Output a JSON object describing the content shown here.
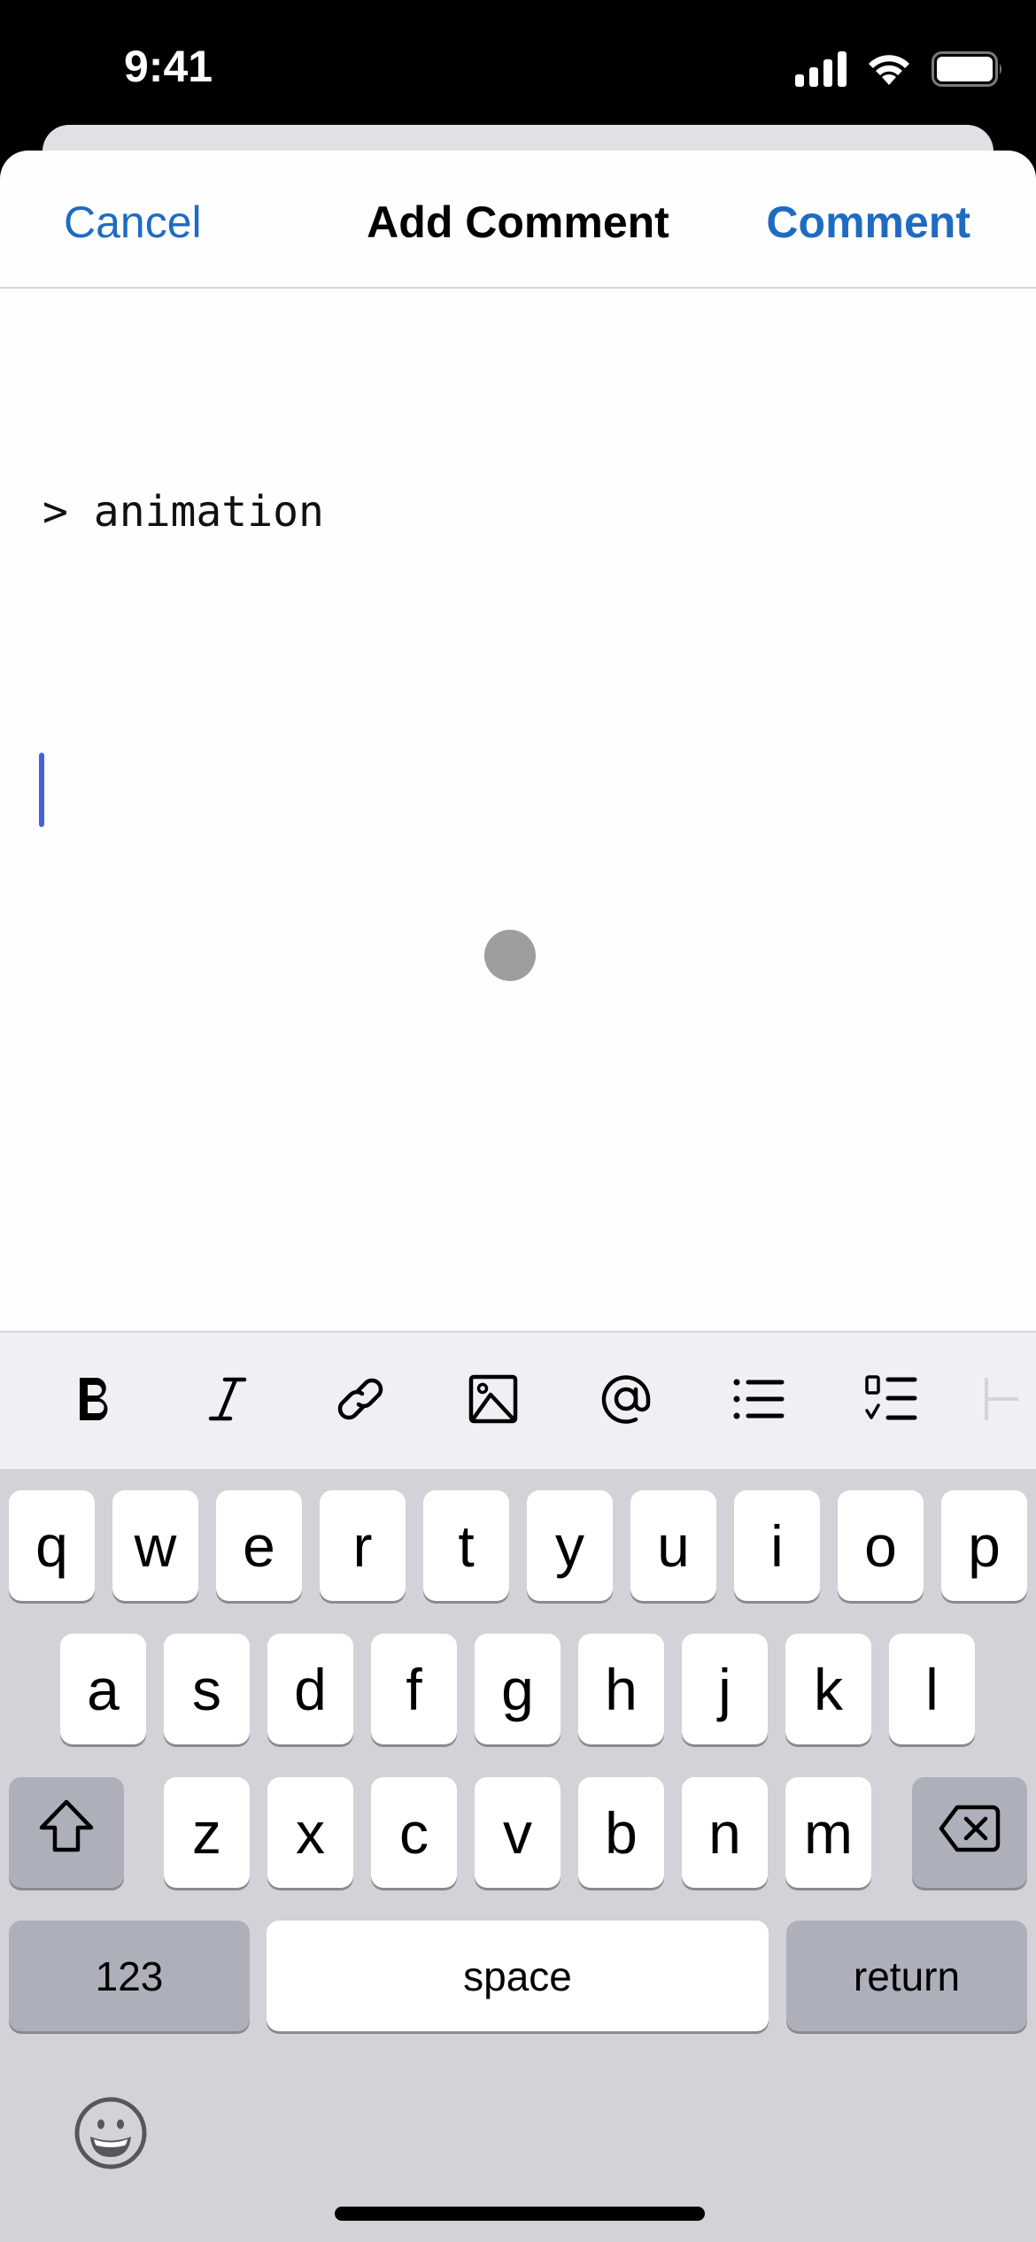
{
  "status_bar": {
    "time": "9:41",
    "icons": [
      "cellular-signal-icon",
      "wifi-icon",
      "battery-icon"
    ],
    "battery_level": 1.0
  },
  "nav": {
    "cancel_label": "Cancel",
    "title": "Add Comment",
    "submit_label": "Comment",
    "accent_color": "#1f6bc2"
  },
  "editor": {
    "quoted_text": "> animation",
    "current_text": "",
    "caret_color": "#4361d8"
  },
  "format_toolbar": {
    "items": [
      {
        "name": "bold",
        "icon": "bold-icon"
      },
      {
        "name": "italic",
        "icon": "italic-icon"
      },
      {
        "name": "link",
        "icon": "link-icon"
      },
      {
        "name": "image",
        "icon": "image-icon"
      },
      {
        "name": "mention",
        "icon": "at-sign-icon"
      },
      {
        "name": "bulleted-list",
        "icon": "bullet-list-icon"
      },
      {
        "name": "task-list",
        "icon": "checklist-icon"
      },
      {
        "name": "heading",
        "icon": "heading-icon"
      }
    ]
  },
  "keyboard": {
    "row1": [
      "q",
      "w",
      "e",
      "r",
      "t",
      "y",
      "u",
      "i",
      "o",
      "p"
    ],
    "row2": [
      "a",
      "s",
      "d",
      "f",
      "g",
      "h",
      "j",
      "k",
      "l"
    ],
    "row3": [
      "z",
      "x",
      "c",
      "v",
      "b",
      "n",
      "m"
    ],
    "shift_icon": "shift-icon",
    "delete_icon": "delete-backspace-icon",
    "numbers_label": "123",
    "space_label": "space",
    "return_label": "return",
    "emoji_icon": "emoji-icon"
  }
}
